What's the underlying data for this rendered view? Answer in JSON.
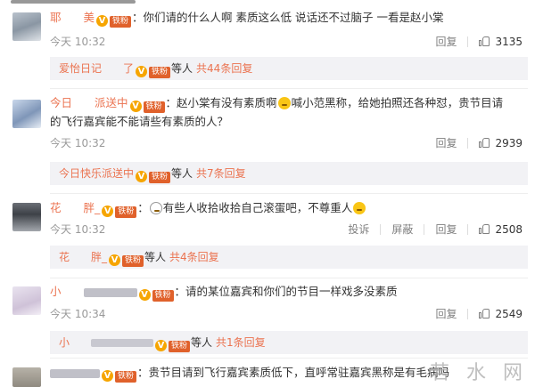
{
  "comments": [
    {
      "username": "耶　　美",
      "fan_badge": "铁粉",
      "text": "你们请的什么人啊 素质这么低 说话还不过脑子 一看是赵小棠",
      "time": "今天 10:32",
      "report": "",
      "block": "",
      "reply": "回复",
      "likes": "3135",
      "reply_summary": {
        "prefix": "",
        "name": "爱怡日记　　了",
        "suffix": "等人",
        "count": "共44条回复"
      }
    },
    {
      "username": "今日　　派送中",
      "fan_badge": "铁粉",
      "text": "赵小棠有没有素质啊",
      "text_after_emoji": "喊小范黑称，给她拍照还各种怼，贵节目请的飞行嘉宾能不能请些有素质的人？",
      "time": "今天 10:32",
      "report": "",
      "block": "",
      "reply": "回复",
      "likes": "2939",
      "reply_summary": {
        "prefix": "",
        "name": "今日快乐派送中",
        "suffix": "等人",
        "count": "共7条回复"
      }
    },
    {
      "username": "花　　胖_",
      "fan_badge": "铁粉",
      "text": "有些人收拾收拾自己滚蛋吧，不尊重人",
      "time": "今天 10:32",
      "report": "投诉",
      "block": "屏蔽",
      "reply": "回复",
      "likes": "2508",
      "reply_summary": {
        "prefix": "",
        "name": "花　　胖_",
        "suffix": "等人",
        "count": "共4条回复"
      }
    },
    {
      "username": "小　　",
      "fan_badge": "铁粉",
      "text": "请的某位嘉宾和你们的节目一样戏多没素质",
      "time": "今天 10:34",
      "report": "",
      "block": "",
      "reply": "回复",
      "likes": "2549",
      "reply_summary": {
        "prefix": "",
        "name": "小　　",
        "suffix": "等人",
        "count": "共1条回复"
      }
    },
    {
      "username": "",
      "fan_badge": "铁粉",
      "text": "贵节目请到飞行嘉宾素质低下，直呼常驻嘉宾黑称是有毛病吗",
      "time": "",
      "report": "",
      "block": "",
      "reply": "",
      "likes": "",
      "reply_summary": {
        "prefix": "",
        "name": "",
        "suffix": "",
        "count": ""
      }
    }
  ],
  "watermark": "若 水 网",
  "colors": {
    "name": "#eb7350",
    "vip": "#f6a500",
    "fan": "#e0612b",
    "reply_bg": "#f2f2f5"
  }
}
